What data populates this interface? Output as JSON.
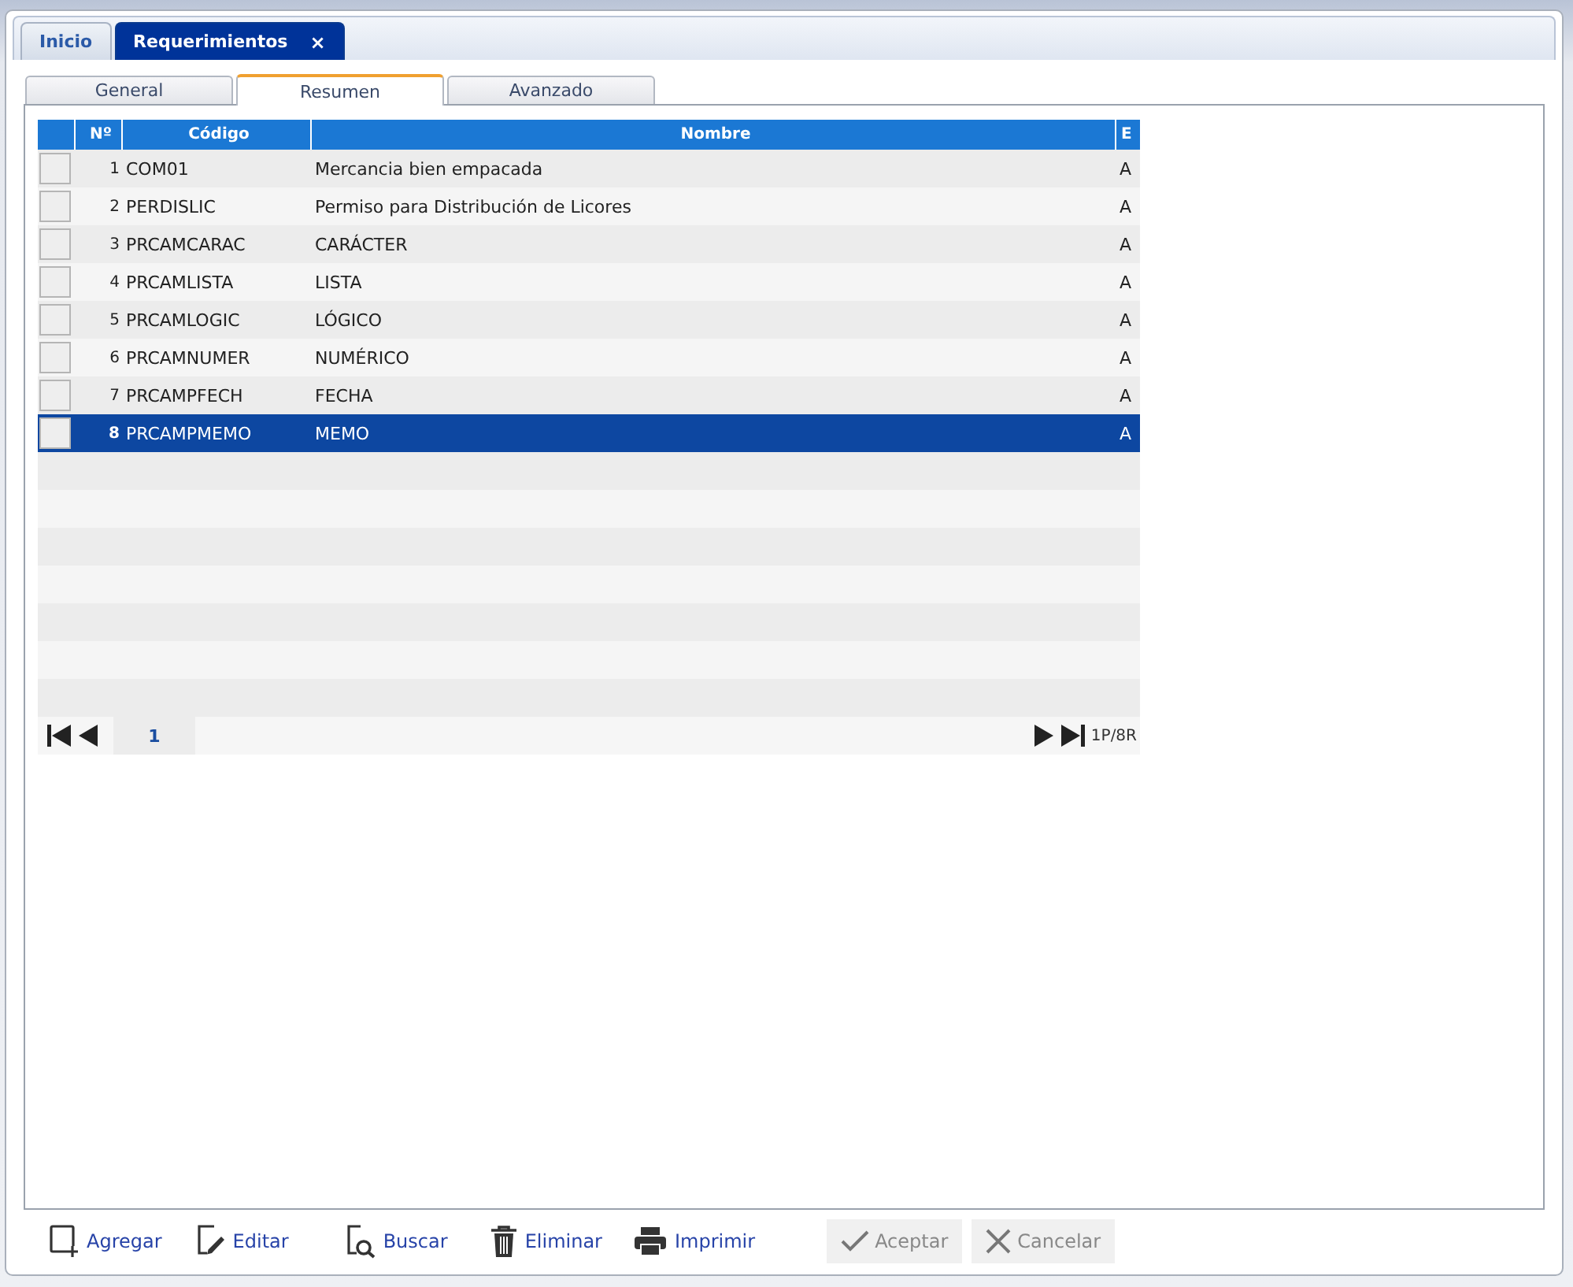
{
  "top_tabs": [
    {
      "label": "Inicio",
      "selected": false
    },
    {
      "label": "Requerimientos",
      "selected": true,
      "close": "×"
    }
  ],
  "sub_tabs": [
    {
      "label": "General",
      "selected": false
    },
    {
      "label": "Resumen",
      "selected": true
    },
    {
      "label": "Avanzado",
      "selected": false
    }
  ],
  "table": {
    "columns": [
      "Nº",
      "Código",
      "Nombre",
      "E"
    ],
    "rows": [
      {
        "n": "1",
        "code": "COM01",
        "name": "Mercancia bien empacada",
        "e": "A",
        "selected": false
      },
      {
        "n": "2",
        "code": "PERDISLIC",
        "name": "Permiso para Distribución de Licores",
        "e": "A",
        "selected": false
      },
      {
        "n": "3",
        "code": "PRCAMCARAC",
        "name": "CARÁCTER",
        "e": "A",
        "selected": false
      },
      {
        "n": "4",
        "code": "PRCAMLISTA",
        "name": "LISTA",
        "e": "A",
        "selected": false
      },
      {
        "n": "5",
        "code": "PRCAMLOGIC",
        "name": "LÓGICO",
        "e": "A",
        "selected": false
      },
      {
        "n": "6",
        "code": "PRCAMNUMER",
        "name": "NUMÉRICO",
        "e": "A",
        "selected": false
      },
      {
        "n": "7",
        "code": "PRCAMPFECH",
        "name": "FECHA",
        "e": "A",
        "selected": false
      },
      {
        "n": "8",
        "code": "PRCAMPMEMO",
        "name": "MEMO",
        "e": "A",
        "selected": true
      }
    ],
    "page": "1",
    "summary": "1P/8R"
  },
  "actions": [
    {
      "kind": "add",
      "label": "Agregar",
      "disabled": false
    },
    {
      "kind": "edit",
      "label": "Editar",
      "disabled": false
    },
    {
      "kind": "search",
      "label": "Buscar",
      "disabled": false
    },
    {
      "kind": "delete",
      "label": "Eliminar",
      "disabled": false
    },
    {
      "kind": "print",
      "label": "Imprimir",
      "disabled": false
    },
    {
      "kind": "accept",
      "label": "Aceptar",
      "disabled": true
    },
    {
      "kind": "cancel",
      "label": "Cancelar",
      "disabled": true
    }
  ]
}
